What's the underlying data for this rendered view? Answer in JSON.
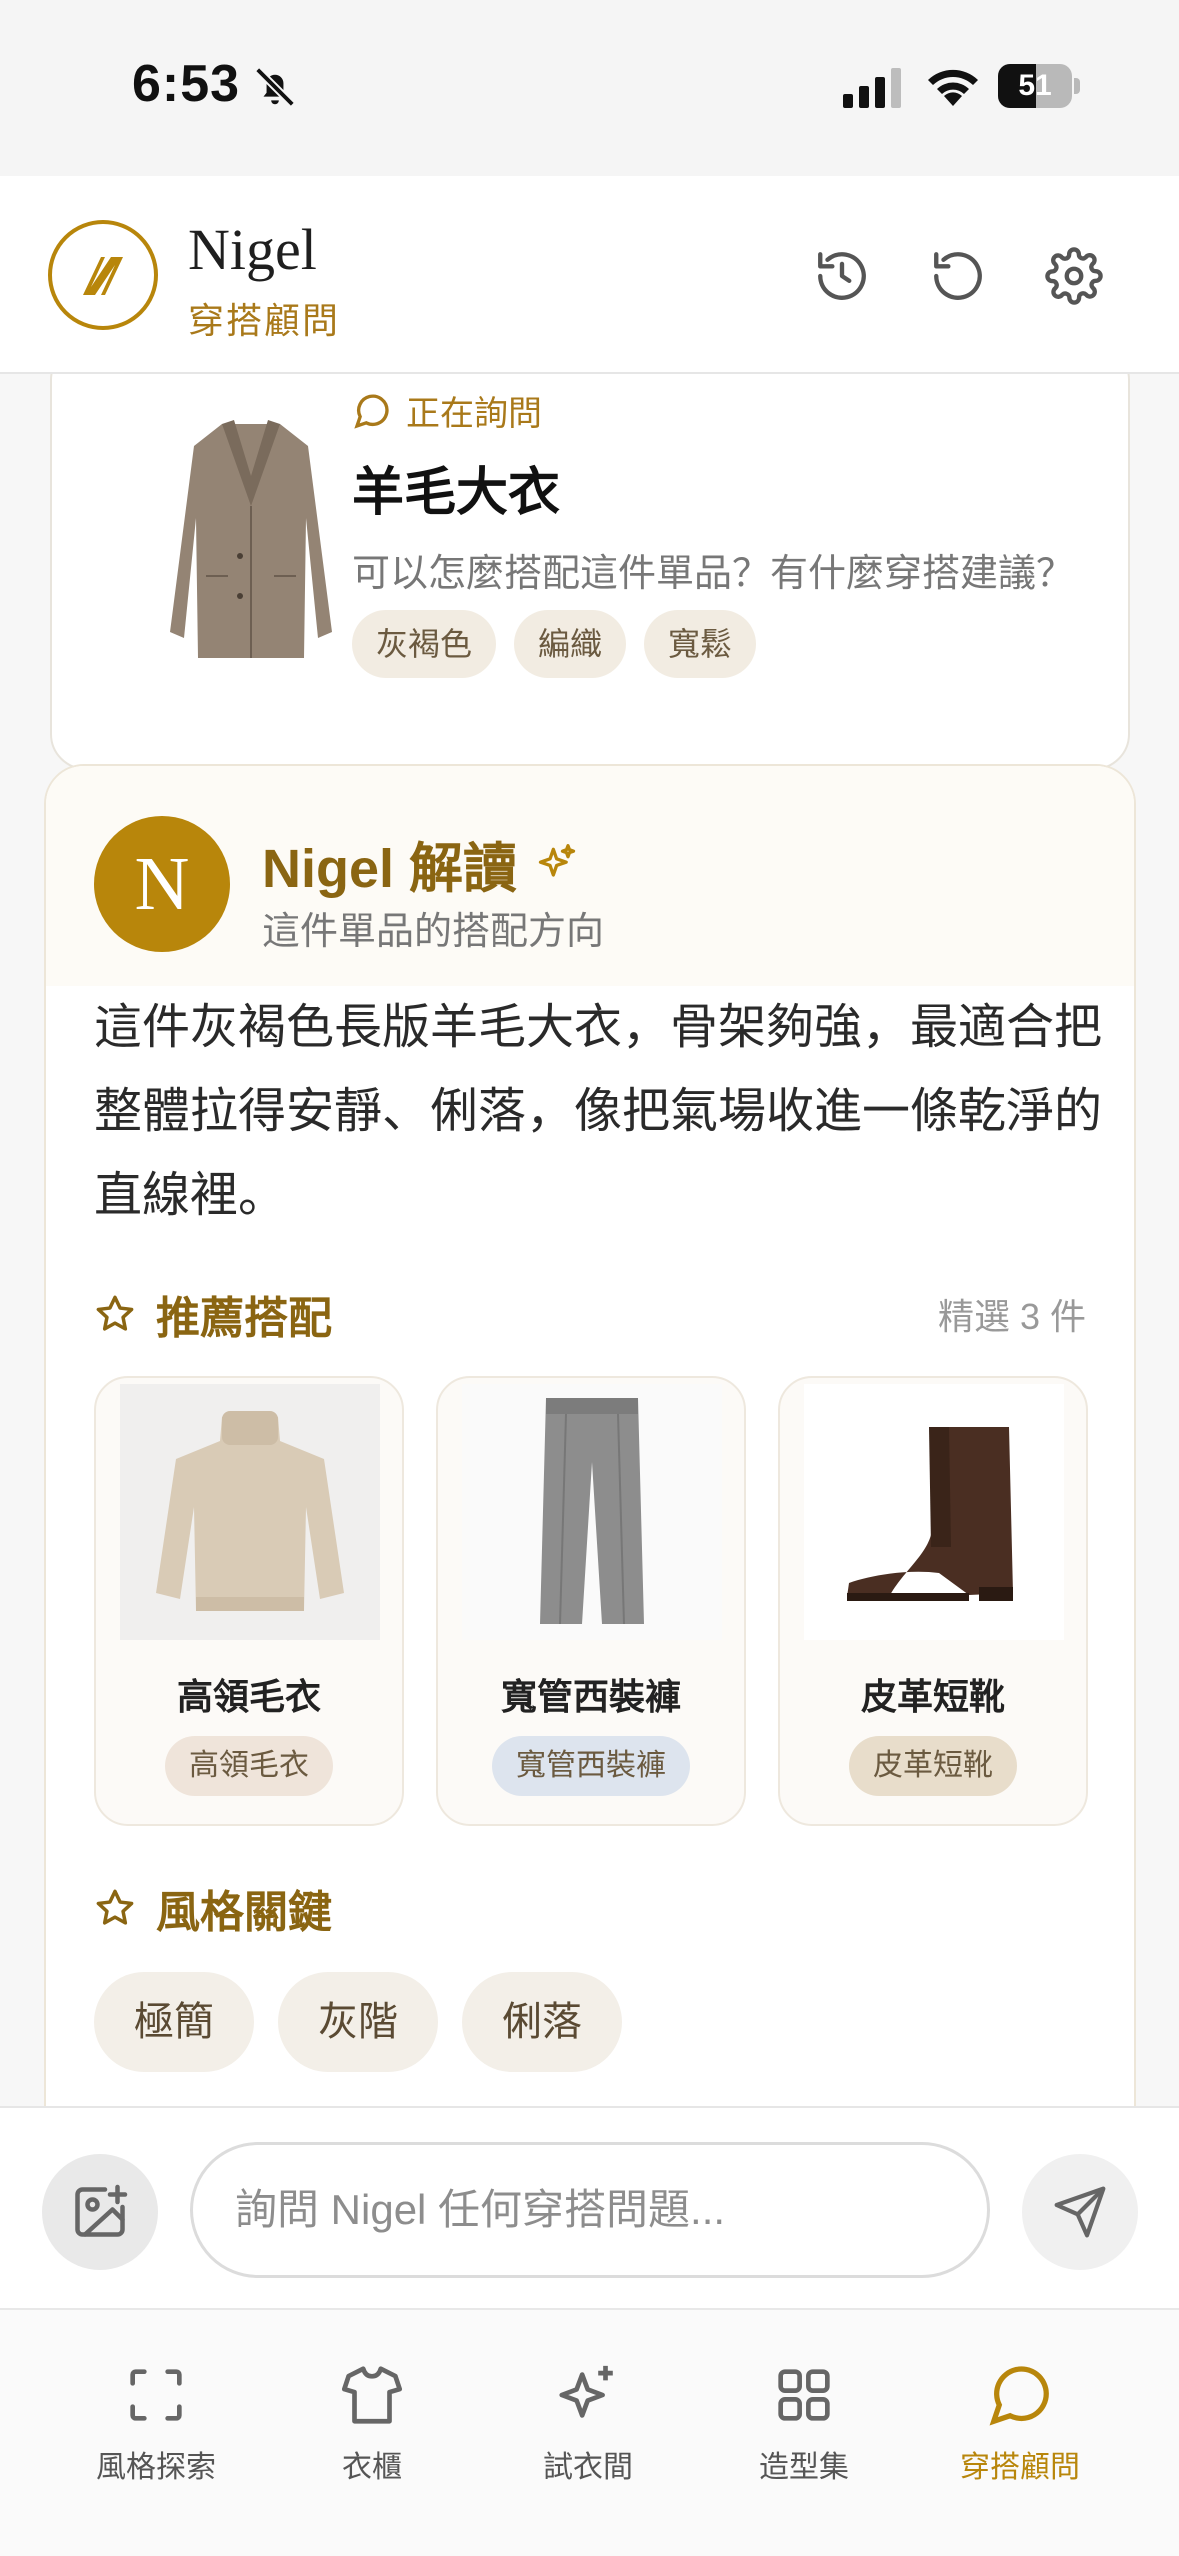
{
  "status_bar": {
    "time": "6:53",
    "battery": "51",
    "battery_level_percent": 51
  },
  "header": {
    "brand": "Nigel",
    "subtitle": "穿搭顧問"
  },
  "asking_card": {
    "tag": "正在詢問",
    "title": "羊毛大衣",
    "question": "可以怎麼搭配這件單品？有什麼穿搭建議？",
    "chips": [
      "灰褐色",
      "編織",
      "寬鬆"
    ]
  },
  "nigel": {
    "avatar_letter": "N",
    "title": "Nigel 解讀",
    "subtitle": "這件單品的搭配方向",
    "body": "這件灰褐色長版羊毛大衣，骨架夠強，最適合把整體拉得安靜、俐落，像把氣場收進一條乾淨的直線裡。",
    "recommend_title": "推薦搭配",
    "recommend_count": "精選 3 件",
    "products": [
      {
        "name": "高領毛衣",
        "tag": "高領毛衣",
        "tag_color": "#efe4da"
      },
      {
        "name": "寬管西裝褲",
        "tag": "寬管西裝褲",
        "tag_color": "#dde4ee"
      },
      {
        "name": "皮革短靴",
        "tag": "皮革短靴",
        "tag_color": "#e8ddcb"
      }
    ],
    "style_title": "風格關鍵",
    "style_chips": [
      "極簡",
      "灰階",
      "俐落"
    ]
  },
  "input": {
    "placeholder": "詢問 Nigel 任何穿搭問題..."
  },
  "tabs": [
    {
      "label": "風格探索",
      "icon": "scan-icon"
    },
    {
      "label": "衣櫃",
      "icon": "shirt-icon"
    },
    {
      "label": "試衣間",
      "icon": "sparkle-icon"
    },
    {
      "label": "造型集",
      "icon": "grid-icon"
    },
    {
      "label": "穿搭顧問",
      "icon": "chat-bubble-icon",
      "active": true
    }
  ],
  "colors": {
    "accent": "#b8860b",
    "accent_dark": "#8a6512"
  }
}
